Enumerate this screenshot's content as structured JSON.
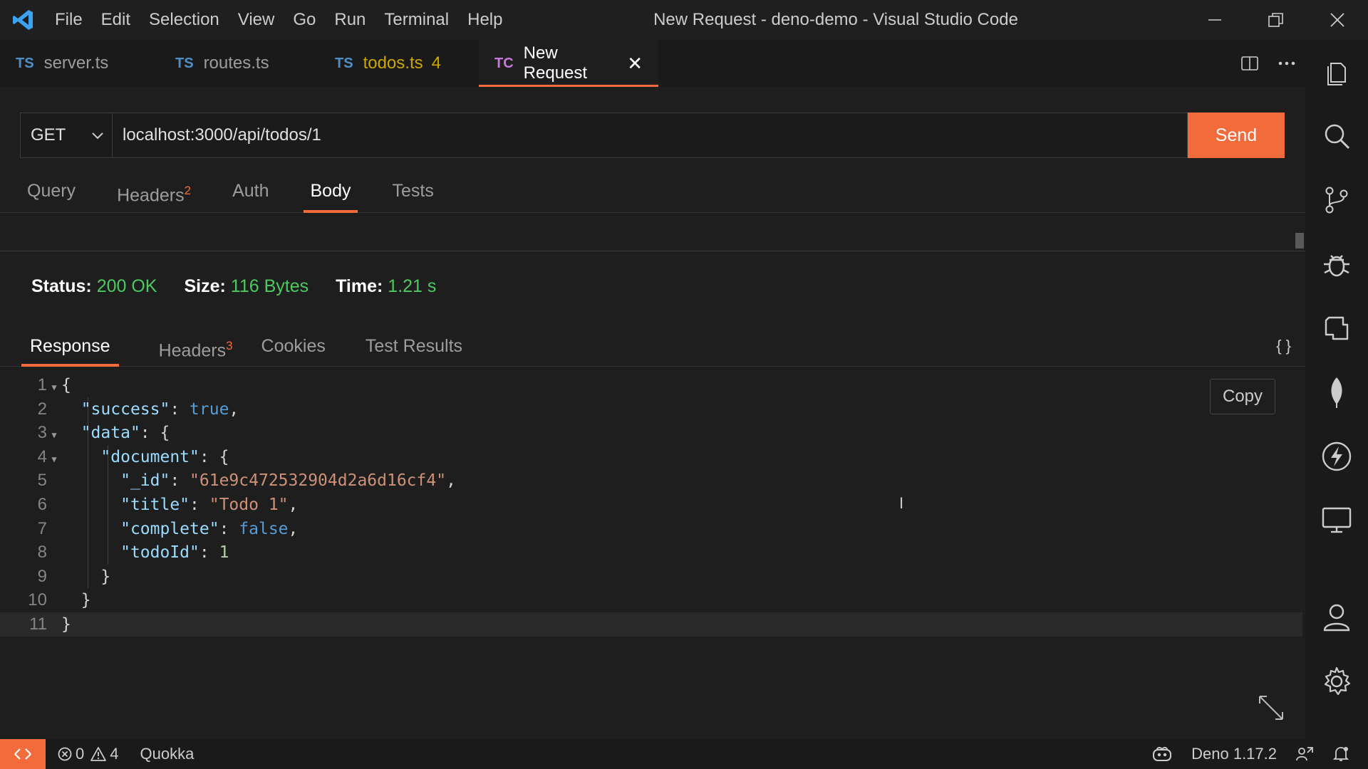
{
  "titlebar": {
    "menu": [
      "File",
      "Edit",
      "Selection",
      "View",
      "Go",
      "Run",
      "Terminal",
      "Help"
    ],
    "title": "New Request - deno-demo - Visual Studio Code"
  },
  "tabs": [
    {
      "lang": "TS",
      "label": "server.ts"
    },
    {
      "lang": "TS",
      "label": "routes.ts"
    },
    {
      "lang": "TS",
      "label": "todos.ts",
      "count": "4"
    },
    {
      "lang": "TC",
      "label": "New Request",
      "close": "✕"
    }
  ],
  "request": {
    "method": "GET",
    "url": "localhost:3000/api/todos/1",
    "send_label": "Send",
    "tabs": {
      "query": "Query",
      "headers": "Headers",
      "headers_count": "2",
      "auth": "Auth",
      "body": "Body",
      "tests": "Tests"
    }
  },
  "status": {
    "status_key": "Status:",
    "status_val": "200 OK",
    "size_key": "Size:",
    "size_val": "116 Bytes",
    "time_key": "Time:",
    "time_val": "1.21 s"
  },
  "response": {
    "tabs": {
      "response": "Response",
      "headers": "Headers",
      "headers_count": "3",
      "cookies": "Cookies",
      "test_results": "Test Results"
    },
    "format_icon": "{ }",
    "copy_label": "Copy",
    "line_numbers": [
      "1",
      "2",
      "3",
      "4",
      "5",
      "6",
      "7",
      "8",
      "9",
      "10",
      "11"
    ],
    "json": {
      "success_key": "\"success\"",
      "success_val": "true",
      "data_key": "\"data\"",
      "document_key": "\"document\"",
      "id_key": "\"_id\"",
      "id_val": "\"61e9c472532904d2a6d16cf4\"",
      "title_key": "\"title\"",
      "title_val": "\"Todo 1\"",
      "complete_key": "\"complete\"",
      "complete_val": "false",
      "todoid_key": "\"todoId\"",
      "todoid_val": "1"
    }
  },
  "statusbar": {
    "errors": "0",
    "warnings": "4",
    "quokka": "Quokka",
    "deno": "Deno 1.17.2"
  },
  "colors": {
    "accent": "#f26b3a",
    "ok": "#4ec960"
  }
}
